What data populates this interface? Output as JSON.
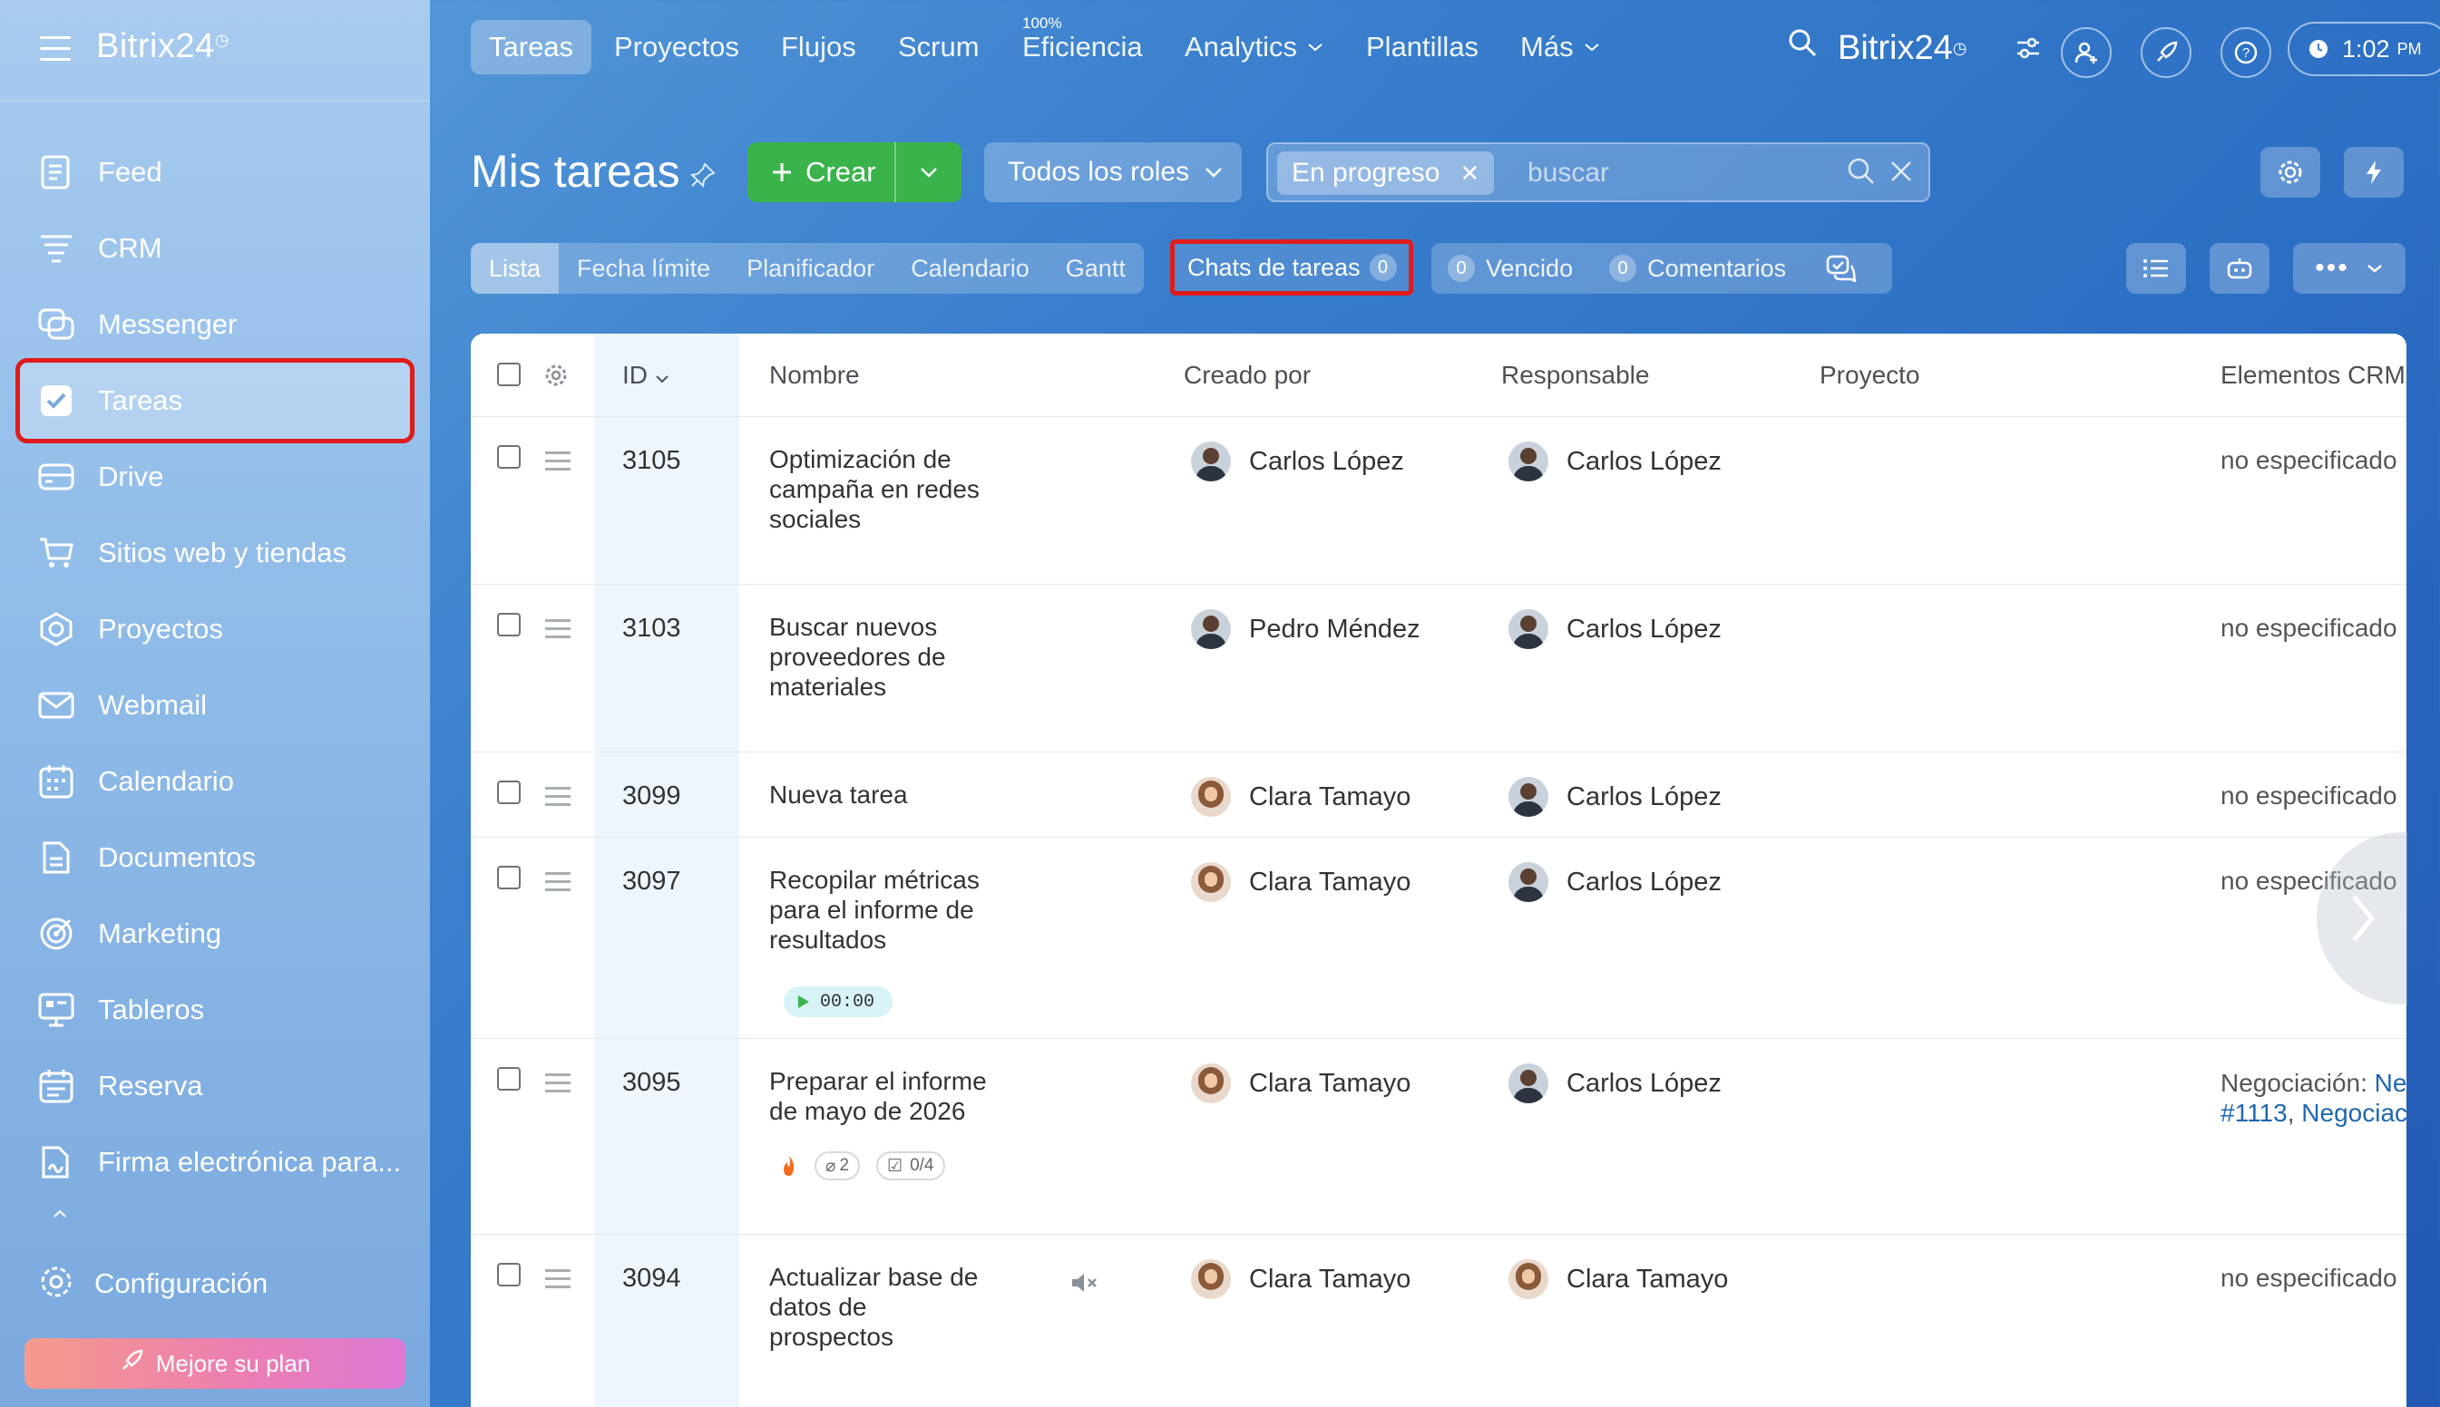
{
  "sidebar": {
    "brand": "Bitrix24",
    "items": [
      {
        "label": "Feed",
        "icon": "feed-icon"
      },
      {
        "label": "CRM",
        "icon": "crm-icon"
      },
      {
        "label": "Messenger",
        "icon": "messenger-icon"
      },
      {
        "label": "Tareas",
        "icon": "tasks-icon",
        "active": true
      },
      {
        "label": "Drive",
        "icon": "drive-icon"
      },
      {
        "label": "Sitios web y tiendas",
        "icon": "cart-icon"
      },
      {
        "label": "Proyectos",
        "icon": "projects-icon"
      },
      {
        "label": "Webmail",
        "icon": "mail-icon"
      },
      {
        "label": "Calendario",
        "icon": "calendar-icon"
      },
      {
        "label": "Documentos",
        "icon": "document-icon"
      },
      {
        "label": "Marketing",
        "icon": "target-icon"
      },
      {
        "label": "Tableros",
        "icon": "board-icon"
      },
      {
        "label": "Reserva",
        "icon": "booking-icon"
      },
      {
        "label": "Firma electrónica para...",
        "icon": "signature-icon"
      }
    ],
    "config_label": "Configuración",
    "upgrade_label": "Mejore su plan"
  },
  "topnav": {
    "tabs": [
      "Tareas",
      "Proyectos",
      "Flujos",
      "Scrum",
      "Eficiencia",
      "Analytics",
      "Plantillas",
      "Más"
    ],
    "efficiency_pct": "100%",
    "brand": "Bitrix24",
    "time": "1:02",
    "ampm": "PM"
  },
  "toolbar": {
    "title": "Mis tareas",
    "create_label": "Crear",
    "roles_label": "Todos los roles",
    "filter_chip": "En progreso",
    "search_placeholder": "buscar"
  },
  "views": {
    "tabs": [
      "Lista",
      "Fecha límite",
      "Planificador",
      "Calendario",
      "Gantt"
    ],
    "chats_label": "Chats de tareas",
    "chats_count": "0",
    "overdue_count": "0",
    "overdue_label": "Vencido",
    "comments_count": "0",
    "comments_label": "Comentarios"
  },
  "table": {
    "columns": {
      "id": "ID",
      "name": "Nombre",
      "created_by": "Creado por",
      "responsible": "Responsable",
      "project": "Proyecto",
      "crm": "Elementos CRM"
    },
    "rows": [
      {
        "id": "3105",
        "name": "Optimización de campaña en redes sociales",
        "created_by": "Carlos López",
        "responsible": "Carlos López",
        "crm": "no especificado"
      },
      {
        "id": "3103",
        "name": "Buscar nuevos proveedores de materiales",
        "created_by": "Pedro Méndez",
        "responsible": "Carlos López",
        "crm": "no especificado"
      },
      {
        "id": "3099",
        "name": "Nueva tarea",
        "created_by": "Clara Tamayo",
        "responsible": "Carlos López",
        "crm": "no especificado"
      },
      {
        "id": "3097",
        "name": "Recopilar métricas para el informe de resultados",
        "created_by": "Clara Tamayo",
        "responsible": "Carlos López",
        "crm": "no especificado",
        "timer": "00:00"
      },
      {
        "id": "3095",
        "name": "Preparar el informe de mayo de 2026",
        "created_by": "Clara Tamayo",
        "responsible": "Carlos López",
        "crm_prefix": "Negociación:",
        "crm_link1": "Ne",
        "crm_link2": "#1113",
        "crm_link3": "Negociac",
        "attachments": "2",
        "checklist": "0/4"
      },
      {
        "id": "3094",
        "name": "Actualizar base de datos de prospectos",
        "created_by": "Clara Tamayo",
        "responsible": "Clara Tamayo",
        "crm": "no especificado"
      }
    ]
  },
  "colors": {
    "accent_green": "#3ab34a",
    "highlight_red": "#e01b1b",
    "link_blue": "#2067b0"
  }
}
